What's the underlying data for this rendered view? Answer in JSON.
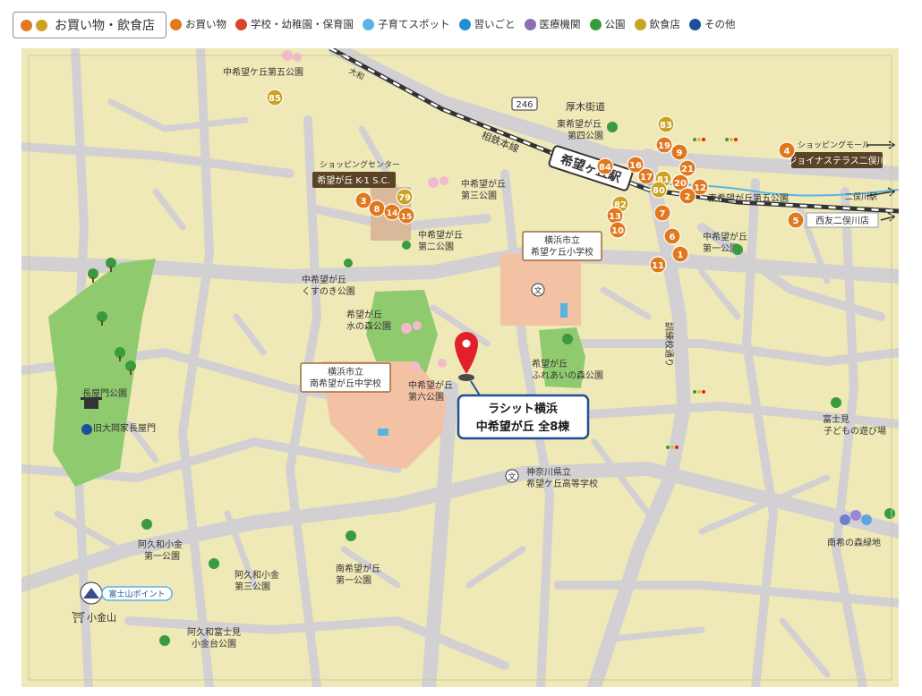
{
  "legend": {
    "group_label": "お買い物・飲食店",
    "group_colors": [
      "#e0781e",
      "#c9a321"
    ],
    "items": [
      {
        "label": "お買い物",
        "color": "#e0781e"
      },
      {
        "label": "学校・幼稚園・保育園",
        "color": "#d9452b"
      },
      {
        "label": "子育てスポット",
        "color": "#58b4e3"
      },
      {
        "label": "習いごと",
        "color": "#1f8fd1"
      },
      {
        "label": "医療機関",
        "color": "#8e6db5"
      },
      {
        "label": "公園",
        "color": "#3a9a3e"
      },
      {
        "label": "飲食店",
        "color": "#c9a321"
      },
      {
        "label": "その他",
        "color": "#1f4f9a"
      }
    ]
  },
  "colors": {
    "map_bg": "#efe9b8",
    "road": "#d2d0d3",
    "park": "#8fcb6e",
    "school": "#f3c1a4",
    "shop_block": "#d9b99a",
    "rail": "#333333",
    "pin": "#e2202a",
    "label_border": "#9b6b3a",
    "shop_marker": "#e0781e",
    "food_marker": "#c9a321",
    "dark_label": "#5a4326"
  },
  "map": {
    "property": {
      "line1": "ラシット横浜",
      "line2": "中希望が丘 全8棟"
    },
    "station": {
      "name": "希望ヶ丘駅"
    },
    "rail": {
      "name": "相鉄本線"
    },
    "roads": {
      "atsugi": "厚木街道",
      "route": "246",
      "kunren": "訓練校通り",
      "yamato": "大和",
      "futamatagawa": "二俣川駅"
    },
    "shops": {
      "k1_caption": "ショッピングセンター",
      "k1_name": "希望が丘 K-1 S.C.",
      "joinus_caption": "ショッピングモール",
      "joinus_name": "ジョイナステラス二俣川",
      "seiyu": "西友二俣川店"
    },
    "schools": {
      "elementary": {
        "line1": "横浜市立",
        "line2": "希望ケ丘小学校"
      },
      "junior_high": {
        "line1": "横浜市立",
        "line2": "南希望が丘中学校"
      },
      "high_school": {
        "line1": "神奈川県立",
        "line2": "希望ケ丘高等学校"
      }
    },
    "parks": {
      "daigo": "中希望ケ丘第五公園",
      "higashi_yon": {
        "line1": "東希望が丘",
        "line2": "第四公園"
      },
      "higashi_go": "東希望が丘第五公園",
      "naka_san": {
        "line1": "中希望が丘",
        "line2": "第三公園"
      },
      "naka_ni": {
        "line1": "中希望が丘",
        "line2": "第二公園"
      },
      "kusunoki": {
        "line1": "中希望が丘",
        "line2": "くすのき公園"
      },
      "mizunomori": {
        "line1": "希望が丘",
        "line2": "水の森公園"
      },
      "naka_roku": {
        "line1": "中希望が丘",
        "line2": "第六公園"
      },
      "fureai": {
        "line1": "希望が丘",
        "line2": "ふれあいの森公園"
      },
      "naka_ichi": {
        "line1": "中希望が丘",
        "line2": "第一公園"
      },
      "nagayamon": "長屋門公園",
      "kyu_ooka": "旧大岡家長屋門",
      "fujimi": {
        "line1": "富士見",
        "line2": "子どもの遊び場"
      },
      "minamikibo_ryokuchi": "南希の森緑地",
      "akuwa_ichi": {
        "line1": "阿久和小金",
        "line2": "第一公園"
      },
      "akuwa_san": {
        "line1": "阿久和小金",
        "line2": "第三公園"
      },
      "minami_ichi": {
        "line1": "南希望が丘",
        "line2": "第一公園"
      },
      "koganedai": {
        "line1": "阿久和富士見",
        "line2": "小金台公園"
      }
    },
    "fuji_point": "富士山ポイント",
    "koganeyama": "小金山",
    "school_symbol": "文",
    "markers": [
      {
        "n": "85",
        "kind": "food"
      },
      {
        "n": "83",
        "kind": "food"
      },
      {
        "n": "19",
        "kind": "shop"
      },
      {
        "n": "9",
        "kind": "shop"
      },
      {
        "n": "16",
        "kind": "shop"
      },
      {
        "n": "17",
        "kind": "shop"
      },
      {
        "n": "21",
        "kind": "shop"
      },
      {
        "n": "84",
        "kind": "shop"
      },
      {
        "n": "81",
        "kind": "food"
      },
      {
        "n": "20",
        "kind": "shop"
      },
      {
        "n": "12",
        "kind": "shop"
      },
      {
        "n": "80",
        "kind": "food"
      },
      {
        "n": "2",
        "kind": "shop"
      },
      {
        "n": "82",
        "kind": "food"
      },
      {
        "n": "7",
        "kind": "shop"
      },
      {
        "n": "13",
        "kind": "shop"
      },
      {
        "n": "10",
        "kind": "shop"
      },
      {
        "n": "6",
        "kind": "shop"
      },
      {
        "n": "1",
        "kind": "shop"
      },
      {
        "n": "11",
        "kind": "shop"
      },
      {
        "n": "4",
        "kind": "shop"
      },
      {
        "n": "5",
        "kind": "shop"
      },
      {
        "n": "79",
        "kind": "food"
      },
      {
        "n": "3",
        "kind": "shop"
      },
      {
        "n": "8",
        "kind": "shop"
      },
      {
        "n": "14",
        "kind": "shop"
      },
      {
        "n": "15",
        "kind": "shop"
      }
    ]
  }
}
